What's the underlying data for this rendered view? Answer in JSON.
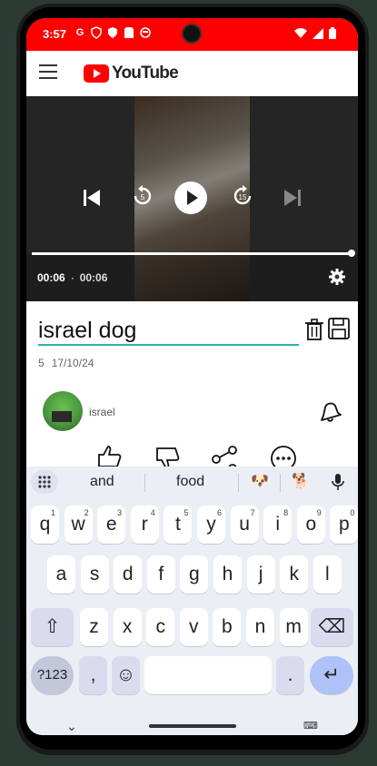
{
  "status_bar": {
    "time": "3:57",
    "left_icons": [
      "G",
      "shield",
      "shield",
      "sim",
      "face"
    ],
    "right_icons": [
      "wifi-icon",
      "signal-icon",
      "battery-icon"
    ],
    "color": "#ff0000"
  },
  "app_bar": {
    "logo_text": "YouTube",
    "menu_icon": "hamburger-menu-icon"
  },
  "player": {
    "current_time": "00:06",
    "separator": "·",
    "duration": "00:06",
    "progress": 1.0,
    "controls": [
      "skip-previous-icon",
      "replay-5-icon",
      "play-icon",
      "forward-15-icon",
      "skip-next-icon"
    ],
    "replay_seconds": "5",
    "forward_seconds": "15"
  },
  "video_info": {
    "title_value": "israel dog",
    "views": "5",
    "date": "17/10/24",
    "channel_name": "israel",
    "accent_color": "#28b3a8"
  },
  "keyboard": {
    "suggestions": [
      "and",
      "food"
    ],
    "emoji_suggestions": [
      "🐶",
      "🐕"
    ],
    "rows": [
      [
        {
          "k": "q",
          "s": "1"
        },
        {
          "k": "w",
          "s": "2"
        },
        {
          "k": "e",
          "s": "3"
        },
        {
          "k": "r",
          "s": "4"
        },
        {
          "k": "t",
          "s": "5"
        },
        {
          "k": "y",
          "s": "6"
        },
        {
          "k": "u",
          "s": "7"
        },
        {
          "k": "i",
          "s": "8"
        },
        {
          "k": "o",
          "s": "9"
        },
        {
          "k": "p",
          "s": "0"
        }
      ],
      [
        {
          "k": "a"
        },
        {
          "k": "s"
        },
        {
          "k": "d"
        },
        {
          "k": "f"
        },
        {
          "k": "g"
        },
        {
          "k": "h"
        },
        {
          "k": "j"
        },
        {
          "k": "k"
        },
        {
          "k": "l"
        }
      ],
      [
        {
          "k": "z"
        },
        {
          "k": "x"
        },
        {
          "k": "c"
        },
        {
          "k": "v"
        },
        {
          "k": "b"
        },
        {
          "k": "n"
        },
        {
          "k": "m"
        }
      ]
    ],
    "symbols_key": "?123",
    "comma_key": ",",
    "emoji_key": "☺",
    "period_key": ".",
    "shift_key": "⇧",
    "delete_key": "⌫",
    "enter_key": "↵",
    "collapse_key": "⌄",
    "switch_key": "⌨"
  }
}
